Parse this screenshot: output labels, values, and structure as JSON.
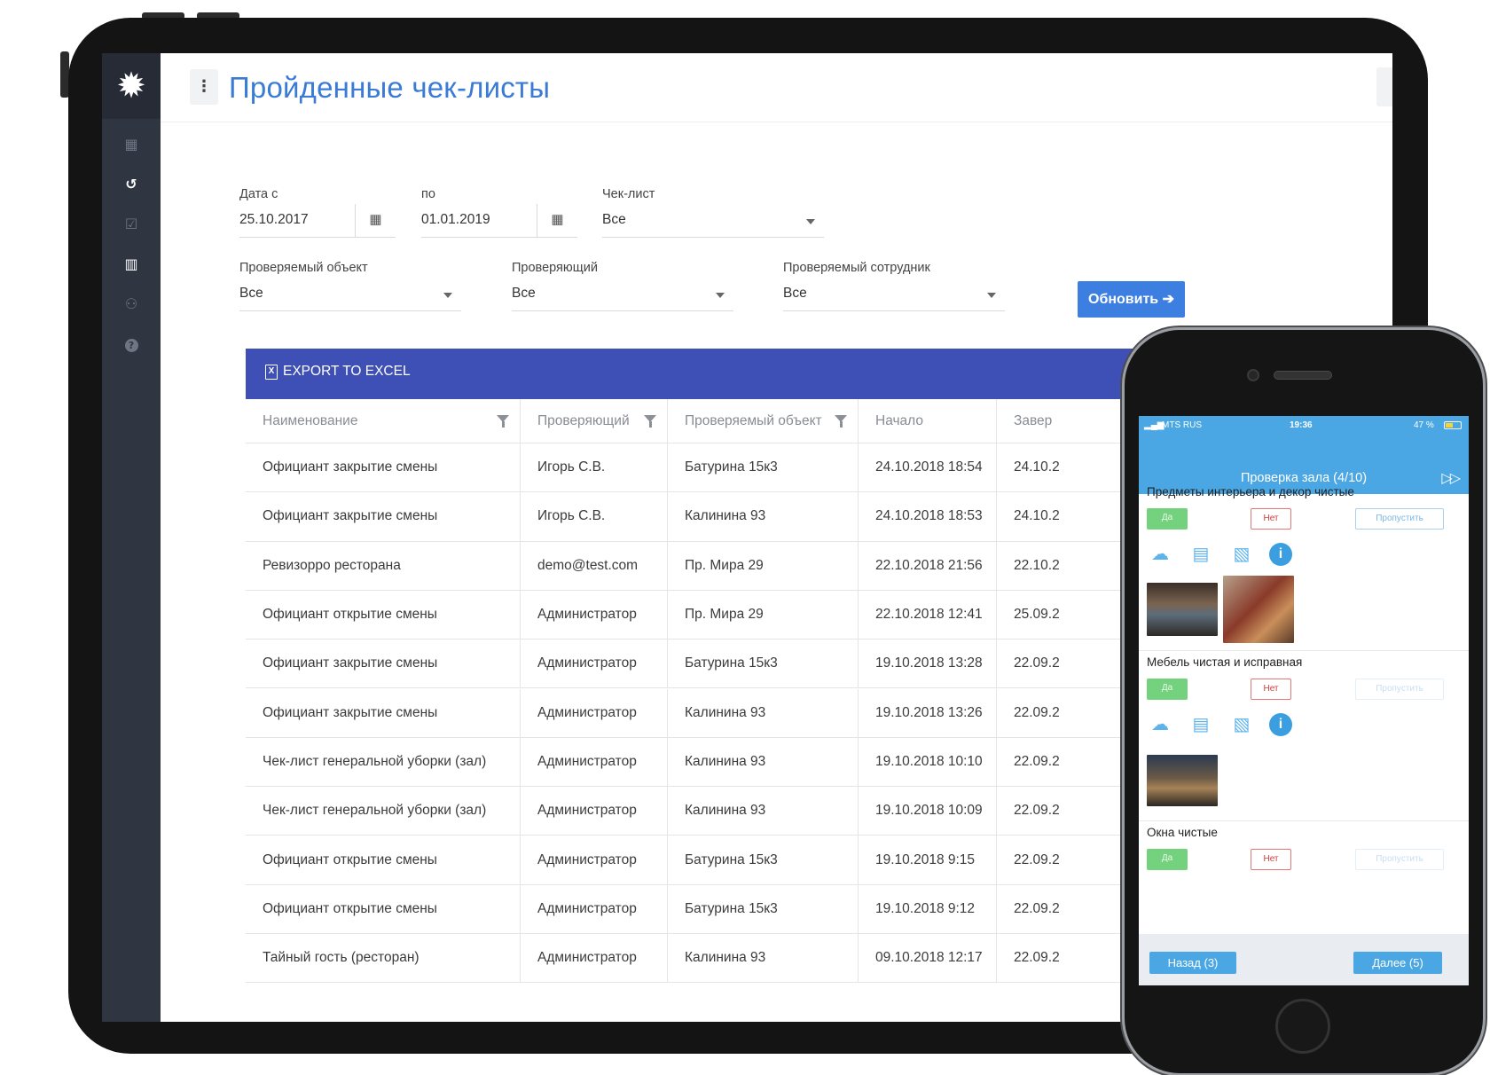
{
  "app": {
    "page_title": "Пройденные чек-листы",
    "kebab_icon": "⋮"
  },
  "sidebar": {
    "logo_icon": "✹",
    "items": [
      {
        "name": "dashboard-icon",
        "glyph": "▦"
      },
      {
        "name": "history-icon",
        "glyph": "↺"
      },
      {
        "name": "checklist-icon",
        "glyph": "☑"
      },
      {
        "name": "chart-icon",
        "glyph": "▥"
      },
      {
        "name": "users-icon",
        "glyph": "⚇"
      },
      {
        "name": "help-icon",
        "glyph": "?"
      }
    ]
  },
  "filters": {
    "date_from_label": "Дата с",
    "date_from_value": "25.10.2017",
    "date_to_label": "по",
    "date_to_value": "01.01.2019",
    "checklist_label": "Чек-лист",
    "checklist_value": "Все",
    "object_label": "Проверяемый объект",
    "object_value": "Все",
    "inspector_label": "Проверяющий",
    "inspector_value": "Все",
    "employee_label": "Проверяемый сотрудник",
    "employee_value": "Все",
    "refresh_label": "Обновить ➔",
    "calendar_icon": "▦"
  },
  "grid": {
    "export_label": "EXPORT TO EXCEL",
    "export_icon": "X",
    "columns": [
      "Наименование",
      "Проверяющий",
      "Проверяемый объект",
      "Начало",
      "Завер"
    ],
    "rows": [
      [
        "Официант закрытие смены",
        "Игорь С.В.",
        "Батурина 15к3",
        "24.10.2018 18:54",
        "24.10.2"
      ],
      [
        "Официант закрытие смены",
        "Игорь С.В.",
        "Калинина 93",
        "24.10.2018 18:53",
        "24.10.2"
      ],
      [
        "Ревизорро ресторана",
        "demo@test.com",
        "Пр. Мира 29",
        "22.10.2018 21:56",
        "22.10.2"
      ],
      [
        "Официант открытие смены",
        "Администратор",
        "Пр. Мира 29",
        "22.10.2018 12:41",
        "25.09.2"
      ],
      [
        "Официант закрытие смены",
        "Администратор",
        "Батурина 15к3",
        "19.10.2018 13:28",
        "22.09.2"
      ],
      [
        "Официант закрытие смены",
        "Администратор",
        "Калинина 93",
        "19.10.2018 13:26",
        "22.09.2"
      ],
      [
        "Чек-лист генеральной уборки (зал)",
        "Администратор",
        "Калинина 93",
        "19.10.2018 10:10",
        "22.09.2"
      ],
      [
        "Чек-лист генеральной уборки (зал)",
        "Администратор",
        "Калинина 93",
        "19.10.2018 10:09",
        "22.09.2"
      ],
      [
        "Официант открытие смены",
        "Администратор",
        "Батурина 15к3",
        "19.10.2018 9:15",
        "22.09.2"
      ],
      [
        "Официант открытие смены",
        "Администратор",
        "Батурина 15к3",
        "19.10.2018 9:12",
        "22.09.2"
      ],
      [
        "Тайный гость (ресторан)",
        "Администратор",
        "Калинина 93",
        "09.10.2018 12:17",
        "22.09.2"
      ]
    ]
  },
  "phone": {
    "carrier": "MTS RUS",
    "time": "19:36",
    "battery": "47 %",
    "nav_title": "Проверка зала (4/10)",
    "skip_icon": "▷▷",
    "yes_label": "Да",
    "no_label": "Нет",
    "skip_label": "Пропустить",
    "questions": [
      "Предметы интерьера и декор чистые",
      "Мебель чистая и исправная",
      "Окна чистые"
    ],
    "back_label": "Назад (3)",
    "next_label": "Далее (5)",
    "tool_icons": [
      "camera-add-icon",
      "comment-add-icon",
      "document-add-icon",
      "info-icon"
    ],
    "info_glyph": "i"
  }
}
